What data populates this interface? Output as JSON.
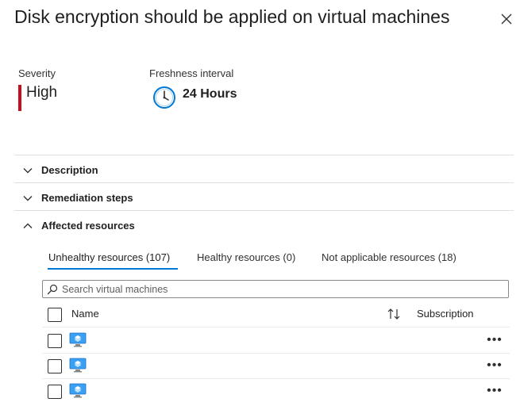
{
  "header": {
    "title": "Disk encryption should be applied on virtual machines"
  },
  "details": {
    "severity_label": "Severity",
    "severity_value": "High",
    "freshness_label": "Freshness interval",
    "freshness_value": "24 Hours"
  },
  "sections": [
    {
      "label": "Description",
      "expanded": false
    },
    {
      "label": "Remediation steps",
      "expanded": false
    },
    {
      "label": "Affected resources",
      "expanded": true
    }
  ],
  "tabs": [
    {
      "label": "Unhealthy resources (107)",
      "active": true
    },
    {
      "label": "Healthy resources (0)",
      "active": false
    },
    {
      "label": "Not applicable resources (18)",
      "active": false
    }
  ],
  "search": {
    "placeholder": "Search virtual machines",
    "value": ""
  },
  "table": {
    "columns": [
      "Name",
      "Subscription"
    ],
    "rows": [
      {
        "name": "",
        "subscription": ""
      },
      {
        "name": "",
        "subscription": ""
      },
      {
        "name": "",
        "subscription": ""
      }
    ]
  },
  "icons": {
    "close": "close-icon",
    "clock": "clock-icon",
    "chevron_down": "chevron-down-icon",
    "chevron_up": "chevron-up-icon",
    "search": "search-icon",
    "sort": "sort-icon",
    "vm": "virtual-machine-icon",
    "more": "more-icon"
  },
  "colors": {
    "accent": "#0078d4",
    "severity_high": "#c50f1f",
    "text": "#323130",
    "divider": "#e1dfdd"
  }
}
